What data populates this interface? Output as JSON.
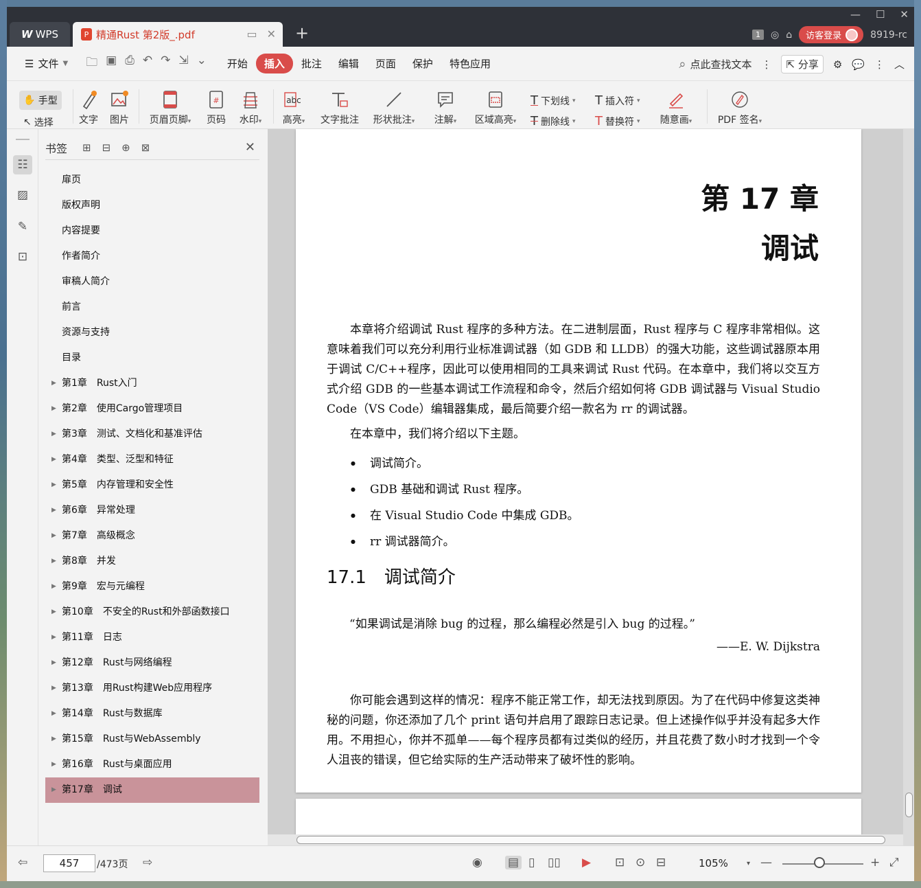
{
  "tabbar": {
    "app_name": "WPS",
    "doc_tab_title": "精通Rust 第2版_.pdf",
    "page_badge": "1",
    "login_label": "访客登录",
    "version_text": "8919-rc"
  },
  "menu": {
    "file_label": "文件",
    "items": [
      "开始",
      "插入",
      "批注",
      "编辑",
      "页面",
      "保护",
      "特色应用"
    ],
    "active_item": "插入",
    "search_label": "点此查找文本",
    "share_label": "分享"
  },
  "ribbon": {
    "hand_label": "手型",
    "select_label": "选择",
    "text_label": "文字",
    "image_label": "图片",
    "header_footer_label": "页眉页脚",
    "page_num_label": "页码",
    "watermark_label": "水印",
    "highlight_label": "高亮",
    "text_annot_label": "文字批注",
    "shape_annot_label": "形状批注",
    "note_label": "注解",
    "area_highlight_label": "区域高亮",
    "underline_label": "下划线",
    "strike_label": "删除线",
    "insert_char_label": "插入符",
    "replace_char_label": "替换符",
    "freehand_label": "随意画",
    "sign_label": "PDF 签名"
  },
  "bookmarks": {
    "title": "书签",
    "items": [
      {
        "label": "扉页",
        "expandable": false
      },
      {
        "label": "版权声明",
        "expandable": false
      },
      {
        "label": "内容提要",
        "expandable": false
      },
      {
        "label": "作者简介",
        "expandable": false
      },
      {
        "label": "审稿人简介",
        "expandable": false
      },
      {
        "label": "前言",
        "expandable": false
      },
      {
        "label": "资源与支持",
        "expandable": false
      },
      {
        "label": "目录",
        "expandable": false
      },
      {
        "label": "第1章　Rust入门",
        "expandable": true
      },
      {
        "label": "第2章　使用Cargo管理项目",
        "expandable": true
      },
      {
        "label": "第3章　测试、文档化和基准评估",
        "expandable": true
      },
      {
        "label": "第4章　类型、泛型和特征",
        "expandable": true
      },
      {
        "label": "第5章　内存管理和安全性",
        "expandable": true
      },
      {
        "label": "第6章　异常处理",
        "expandable": true
      },
      {
        "label": "第7章　高级概念",
        "expandable": true
      },
      {
        "label": "第8章　并发",
        "expandable": true
      },
      {
        "label": "第9章　宏与元编程",
        "expandable": true
      },
      {
        "label": "第10章　不安全的Rust和外部函数接口",
        "expandable": true
      },
      {
        "label": "第11章　日志",
        "expandable": true
      },
      {
        "label": "第12章　Rust与网络编程",
        "expandable": true
      },
      {
        "label": "第13章　用Rust构建Web应用程序",
        "expandable": true
      },
      {
        "label": "第14章　Rust与数据库",
        "expandable": true
      },
      {
        "label": "第15章　Rust与WebAssembly",
        "expandable": true
      },
      {
        "label": "第16章　Rust与桌面应用",
        "expandable": true
      },
      {
        "label": "第17章　调试",
        "expandable": true,
        "selected": true
      }
    ]
  },
  "page": {
    "chapter_line1": "第 17 章",
    "chapter_line2": "调试",
    "intro_paragraph": "本章将介绍调试 Rust 程序的多种方法。在二进制层面，Rust 程序与 C 程序非常相似。这意味着我们可以充分利用行业标准调试器（如 GDB 和 LLDB）的强大功能，这些调试器原本用于调试 C/C++程序，因此可以使用相同的工具来调试 Rust 代码。在本章中，我们将以交互方式介绍 GDB 的一些基本调试工作流程和命令，然后介绍如何将 GDB 调试器与 Visual Studio Code（VS Code）编辑器集成，最后简要介绍一款名为 rr 的调试器。",
    "topics_intro": "在本章中，我们将介绍以下主题。",
    "topics": [
      "调试简介。",
      "GDB 基础和调试 Rust 程序。",
      "在 Visual Studio Code 中集成 GDB。",
      "rr 调试器简介。"
    ],
    "section_title": "17.1　调试简介",
    "quote": "“如果调试是消除 bug 的过程，那么编程必然是引入 bug 的过程。”",
    "quote_author": "——E. W. Dijkstra",
    "body_paragraph": "你可能会遇到这样的情况：程序不能正常工作，却无法找到原因。为了在代码中修复这类神秘的问题，你还添加了几个 print 语句并启用了跟踪日志记录。但上述操作似乎并没有起多大作用。不用担心，你并不孤单——每个程序员都有过类似的经历，并且花费了数小时才找到一个令人沮丧的错误，但它给实际的生产活动带来了破坏性的影响。"
  },
  "statusbar": {
    "current_page": "457",
    "total_pages": "/473页",
    "zoom": "105%"
  },
  "colors": {
    "accent": "#d94c4a",
    "selected_bookmark": "#c9939a",
    "titlebar": "#2e3138"
  }
}
